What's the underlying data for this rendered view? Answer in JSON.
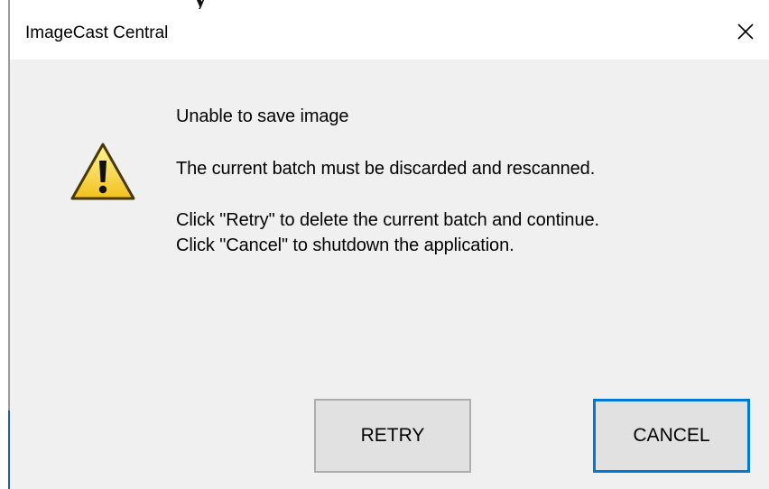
{
  "window": {
    "title": "ImageCast Central",
    "close_icon": "close-icon"
  },
  "message": {
    "icon": "warning-icon",
    "line1": "Unable to save image",
    "line2": "The current batch must be discarded and rescanned.",
    "line3": "Click \"Retry\" to delete the current batch and continue.",
    "line4": "Click \"Cancel\" to shutdown the application."
  },
  "buttons": {
    "retry_label": "RETRY",
    "cancel_label": "CANCEL"
  },
  "colors": {
    "client_bg": "#f0f0f0",
    "button_bg": "#e1e1e1",
    "focus_border": "#0078d7",
    "warning_fill": "#f9d83a"
  }
}
